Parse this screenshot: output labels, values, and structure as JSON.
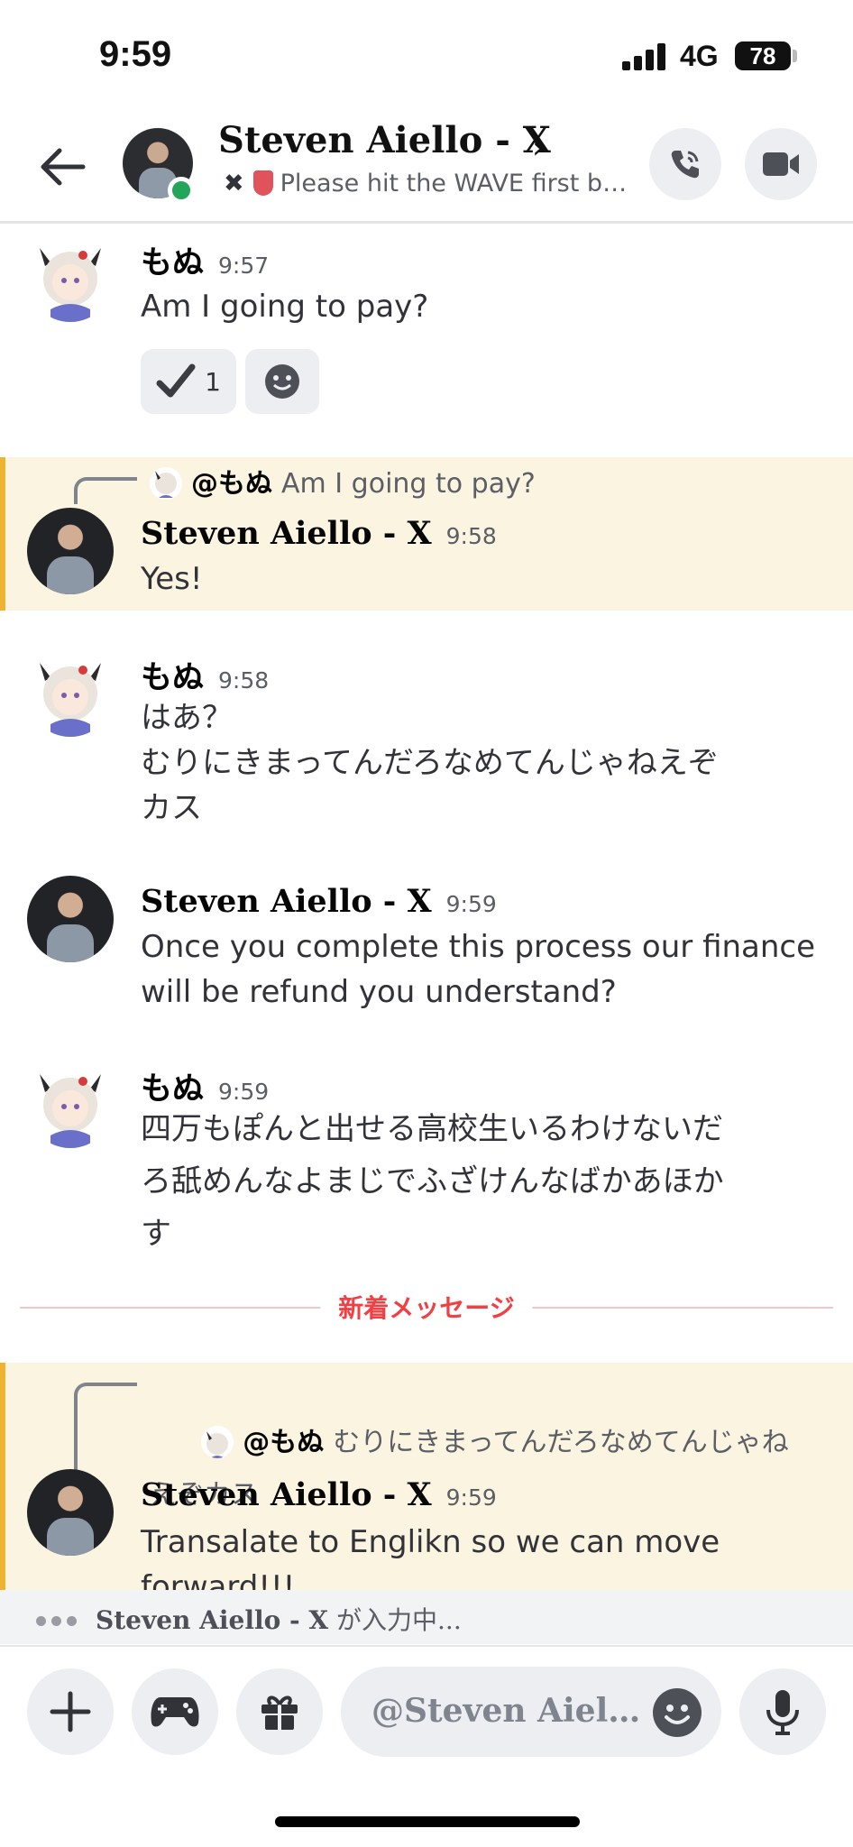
{
  "status_bar": {
    "time": "9:59",
    "network": "4G",
    "battery": "78"
  },
  "header": {
    "name": "Steven Aiello - X",
    "status_x": "✖",
    "status_text": "Please hit the WAVE first bef..."
  },
  "messages": [
    {
      "author": "もぬ",
      "time": "9:57",
      "text": "Am I going to pay?",
      "reaction_count": "1"
    },
    {
      "reply_mention": "@もぬ",
      "reply_text": "Am I going to pay?",
      "author": "Steven Aiello - X",
      "time": "9:58",
      "text": "Yes!"
    },
    {
      "author": "もぬ",
      "time": "9:58",
      "text": "はあ？\nむりにきまってんだろなめてんじゃねえぞ\nカス"
    },
    {
      "author": "Steven Aiello - X",
      "time": "9:59",
      "text": "Once you complete this process our finance\nwill be refund you understand?"
    },
    {
      "author": "もぬ",
      "time": "9:59",
      "text": "四万もぽんと出せる高校生いるわけないだ\nろ舐めんなよまじでふざけんなばかあほか\nす"
    },
    {
      "reply_mention": "@もぬ",
      "reply_text": "むりにきまってんだろなめてんじゃね\nえぞカス",
      "author": "Steven Aiello - X",
      "time": "9:59",
      "text": "Transalate to Englikn so we can move\nforward!!!"
    }
  ],
  "divider_label": "新着メッセージ",
  "typing": {
    "name": "Steven Aiello - X",
    "suffix": " が入力中..."
  },
  "composer": {
    "placeholder": "@Steven Aiello..."
  }
}
